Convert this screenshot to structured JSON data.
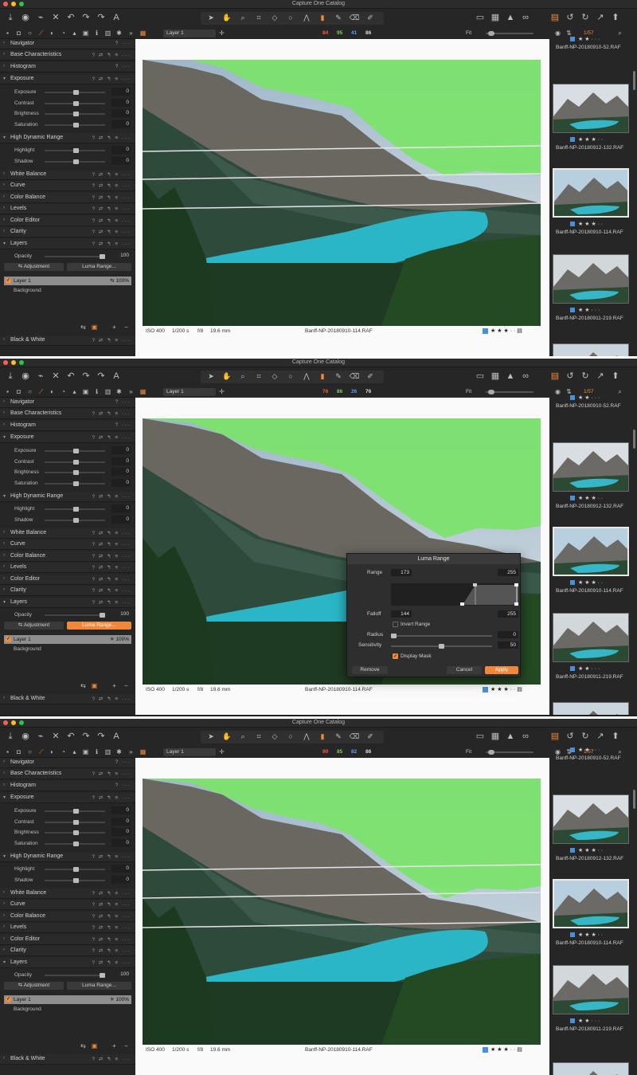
{
  "window": {
    "title": "Capture One Catalog"
  },
  "toolbar": {
    "left_icons": [
      "import-icon",
      "camera-icon",
      "tether-icon",
      "delete-icon",
      "undo-icon",
      "redo-icon",
      "redo-alt-icon",
      "text-icon"
    ],
    "right_icons": [
      "monitor-icon",
      "grid-icon",
      "warning-icon",
      "glasses-icon",
      "stack-icon",
      "rotate-left-icon",
      "rotate-right-icon",
      "export-icon",
      "share-icon"
    ]
  },
  "tool_tabs": [
    "library-icon",
    "capture-icon",
    "lens-icon",
    "adjust-icon",
    "color-icon",
    "exposure-icon",
    "details-icon",
    "adjustments-icon",
    "metadata-icon",
    "output-icon",
    "settings-icon"
  ],
  "viewer": {
    "layer_select": "Layer 1",
    "fit_label": "Fit",
    "file_name": "Banff-NP-20180910-114.RAF",
    "iso": "ISO 400",
    "shutter": "1/200 s",
    "aperture": "f/8",
    "focal": "19.6 mm",
    "stars": "★ ★ ★ · ·"
  },
  "browser": {
    "counter": "1/57"
  },
  "panel": {
    "navigator": "Navigator",
    "base": "Base Characteristics",
    "histogram": "Histogram",
    "exposure": "Exposure",
    "exposure_rows": [
      {
        "label": "Exposure",
        "value": "0"
      },
      {
        "label": "Contrast",
        "value": "0"
      },
      {
        "label": "Brightness",
        "value": "0"
      },
      {
        "label": "Saturation",
        "value": "0"
      }
    ],
    "hdr": "High Dynamic Range",
    "hdr_rows": [
      {
        "label": "Highlight",
        "value": "0"
      },
      {
        "label": "Shadow",
        "value": "0"
      }
    ],
    "white_balance": "White Balance",
    "curve": "Curve",
    "color_balance": "Color Balance",
    "levels": "Levels",
    "color_editor": "Color Editor",
    "clarity": "Clarity",
    "layers": "Layers",
    "opacity_label": "Opacity",
    "opacity_value": "100",
    "adjustment_btn": "Adjustment",
    "luma_btn": "Luma Range...",
    "layer_name": "Layer 1",
    "layer_opacity": "100%",
    "background": "Background",
    "bw": "Black & White",
    "actions": "? ⇄ ↰ ≡ ···",
    "actions_short": "? ···"
  },
  "shots": [
    {
      "rgb": [
        "84",
        "95",
        "41",
        "86"
      ]
    },
    {
      "rgb": [
        "76",
        "86",
        "26",
        "76"
      ]
    },
    {
      "rgb": [
        "90",
        "85",
        "82",
        "86"
      ]
    }
  ],
  "thumbs": [
    {
      "name": "Banff-NP-20180910-52.RAF",
      "stars": "★ ★ · · ·"
    },
    {
      "name": "Banff-NP-20180912-132.RAF",
      "stars": "★ ★ ★ · ·"
    },
    {
      "name": "Banff-NP-20180910-114.RAF",
      "stars": "★ ★ ★ · ·"
    },
    {
      "name": "Banff-NP-20180911-219.RAF",
      "stars": "★ ★ · · ·"
    }
  ],
  "dialog": {
    "title": "Luma Range",
    "range_label": "Range",
    "range_low": "173",
    "range_high": "255",
    "falloff_label": "Falloff",
    "falloff_low": "144",
    "falloff_high": "255",
    "invert_label": "Invert Range",
    "radius_label": "Radius",
    "radius_value": "0",
    "sensitivity_label": "Sensitivity",
    "sensitivity_value": "50",
    "display_mask_label": "Display Mask",
    "remove_btn": "Remove",
    "cancel_btn": "Cancel",
    "apply_btn": "Apply"
  },
  "colors": {
    "accent": "#f08a3a",
    "mask": "#7be36b",
    "lake": "#2ab6c9",
    "label_blue": "#4a90d9"
  }
}
